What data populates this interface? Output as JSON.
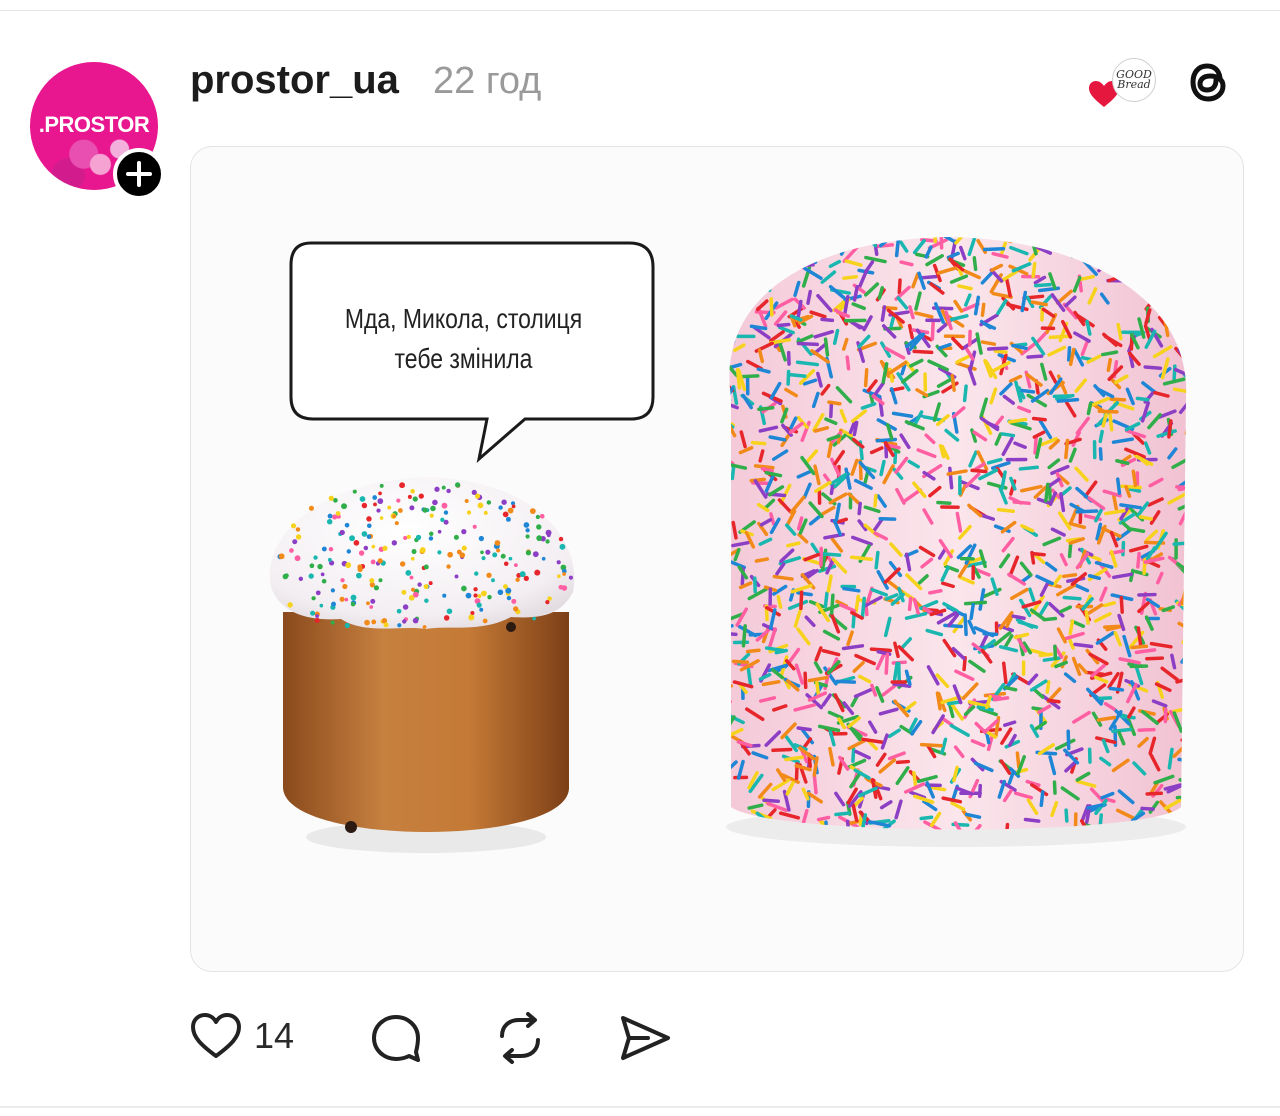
{
  "post": {
    "avatar_text": ".PROSTOR",
    "username": "prostor_ua",
    "timestamp": "22 год",
    "brand_badge_text": "GOOD Bread",
    "meme_text": "Мда, Микола, столиця тебе змінила",
    "likes": "14"
  },
  "icons": {
    "follow": "plus-icon",
    "heart_badge": "heart-icon",
    "threads": "threads-logo-icon",
    "like": "heart-outline-icon",
    "comment": "comment-icon",
    "repost": "repost-icon",
    "share": "send-icon"
  },
  "colors": {
    "brand_pink": "#e8178f",
    "badge_heart": "#e5173f",
    "text": "#1c1c1c",
    "muted": "#9a9a9a"
  }
}
